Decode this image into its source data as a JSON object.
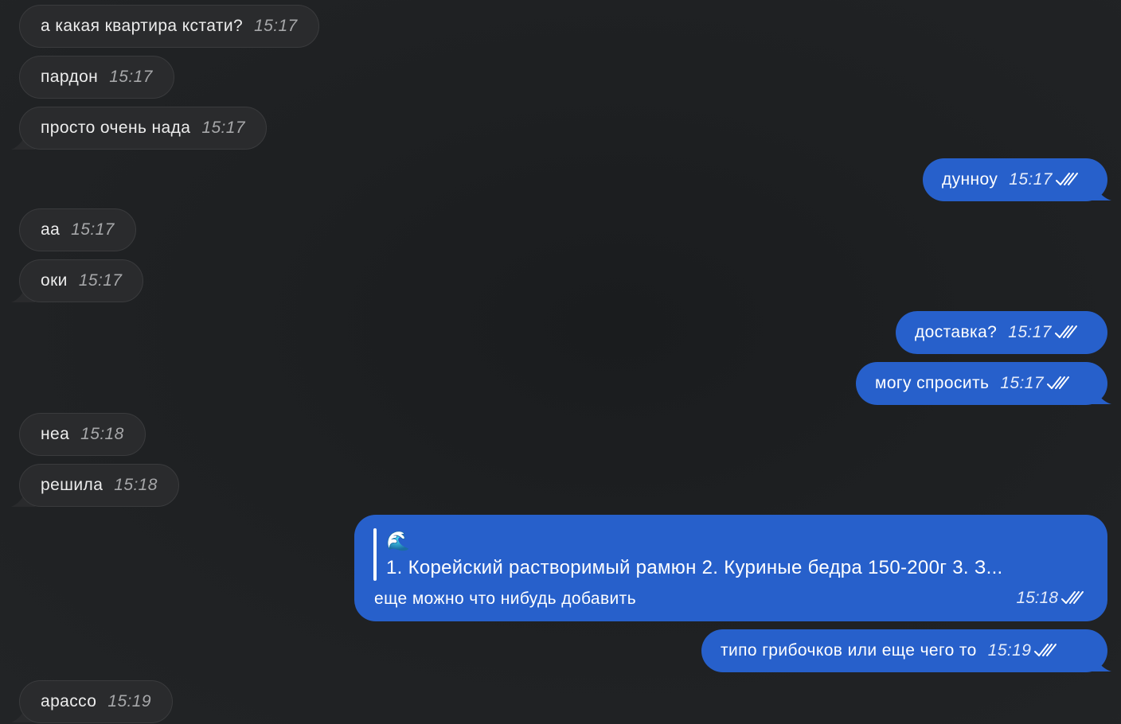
{
  "messages": [
    {
      "text": "а какая квартира кстати?",
      "time": "15:17"
    },
    {
      "text": "пардон",
      "time": "15:17"
    },
    {
      "text": "просто очень нада",
      "time": "15:17"
    },
    {
      "text": "дунноу",
      "time": "15:17"
    },
    {
      "text": "аа",
      "time": "15:17"
    },
    {
      "text": "оки",
      "time": "15:17"
    },
    {
      "text": "доставка?",
      "time": "15:17"
    },
    {
      "text": "могу спросить",
      "time": "15:17"
    },
    {
      "text": "неа",
      "time": "15:18"
    },
    {
      "text": "решила",
      "time": "15:18"
    },
    {
      "quote_emoji": "🌊",
      "quote_text": "1. Корейский растворимый рамюн  2. Куриные бедра 150-200г  3. З...",
      "text": "еще можно что нибудь добавить",
      "time": "15:18"
    },
    {
      "text": "типо грибочков или еще чего то",
      "time": "15:19"
    },
    {
      "text": "арассо",
      "time": "15:19"
    }
  ],
  "colors": {
    "background": "#212325",
    "incoming_bubble": "#2a2b2d",
    "outgoing_bubble": "#2760cb"
  },
  "icons": {
    "read_receipt": "double-check-icon",
    "message_tail": "bubble-tail-icon"
  }
}
